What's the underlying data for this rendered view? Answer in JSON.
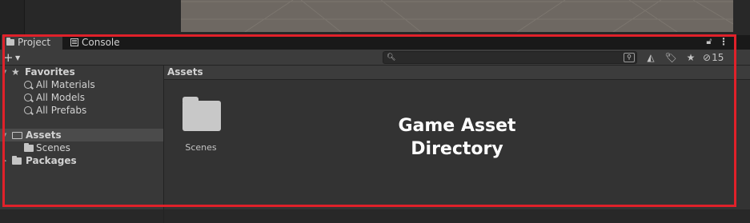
{
  "tabs": [
    {
      "label": "Project",
      "active": true
    },
    {
      "label": "Console",
      "active": false
    }
  ],
  "toolbar": {
    "create_label": "+",
    "search_value": "",
    "hidden_count": "15"
  },
  "sidebar": {
    "favorites": {
      "label": "Favorites",
      "items": [
        {
          "label": "All Materials"
        },
        {
          "label": "All Models"
        },
        {
          "label": "All Prefabs"
        }
      ]
    },
    "assets": {
      "label": "Assets",
      "children": [
        {
          "label": "Scenes"
        }
      ]
    },
    "packages": {
      "label": "Packages"
    }
  },
  "content": {
    "header": "Assets",
    "items": [
      {
        "label": "Scenes",
        "icon": "folder-icon"
      }
    ]
  },
  "annotation": {
    "text": "Game Asset\nDirectory",
    "box_color": "#e0212a"
  }
}
